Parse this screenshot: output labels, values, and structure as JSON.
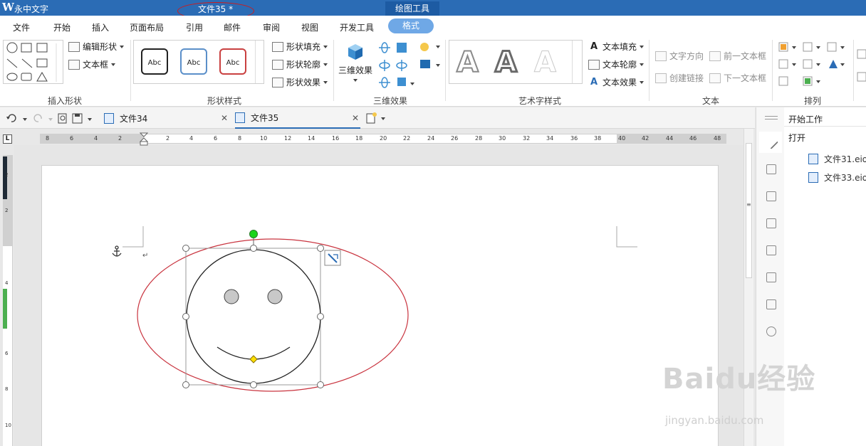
{
  "titlebar": {
    "app_name": "永中文字",
    "doc_title": "文件35 *",
    "context_tab_group": "绘图工具",
    "accent_color": "#2b6cb5"
  },
  "menubar": {
    "items": [
      {
        "label": "文件"
      },
      {
        "label": "开始"
      },
      {
        "label": "插入"
      },
      {
        "label": "页面布局"
      },
      {
        "label": "引用"
      },
      {
        "label": "邮件"
      },
      {
        "label": "审阅"
      },
      {
        "label": "视图"
      },
      {
        "label": "开发工具"
      },
      {
        "label": "格式",
        "active": true
      }
    ]
  },
  "ribbon": {
    "insert_shapes": {
      "label": "插入形状",
      "edit_shape": "编辑形状",
      "text_box": "文本框"
    },
    "shape_styles": {
      "label": "形状样式",
      "presets": [
        "Abc",
        "Abc",
        "Abc"
      ],
      "fill": "形状填充",
      "outline": "形状轮廓",
      "effect": "形状效果"
    },
    "three_d": {
      "label": "三维效果",
      "button": "三维效果"
    },
    "wordart": {
      "label": "艺术字样式",
      "text_fill": "文本填充",
      "text_outline": "文本轮廓",
      "text_effect": "文本效果"
    },
    "text": {
      "label": "文本",
      "direction": "文字方向",
      "create_link": "创建链接",
      "prev_box": "前一文本框",
      "next_box": "下一文本框"
    },
    "arrange": {
      "label": "排列"
    }
  },
  "tabs": [
    {
      "label": "文件34"
    },
    {
      "label": "文件35",
      "active": true
    }
  ],
  "ruler": {
    "h_ticks_left": [
      "8",
      "6",
      "4",
      "2"
    ],
    "h_ticks": [
      "2",
      "4",
      "6",
      "8",
      "10",
      "12",
      "14",
      "16",
      "18",
      "20",
      "22",
      "24",
      "26",
      "28",
      "30",
      "32",
      "34",
      "36",
      "38",
      "40",
      "42",
      "44",
      "46",
      "48"
    ],
    "v_ticks": [
      "2",
      "2",
      "4",
      "6",
      "8",
      "10"
    ],
    "corner": "L"
  },
  "side_panel": {
    "title": "开始工作",
    "open": "打开",
    "recent_files": [
      "文件31.eio",
      "文件33.eio"
    ]
  },
  "watermark": {
    "brand": "Baidu经验",
    "url": "jingyan.baidu.com"
  }
}
